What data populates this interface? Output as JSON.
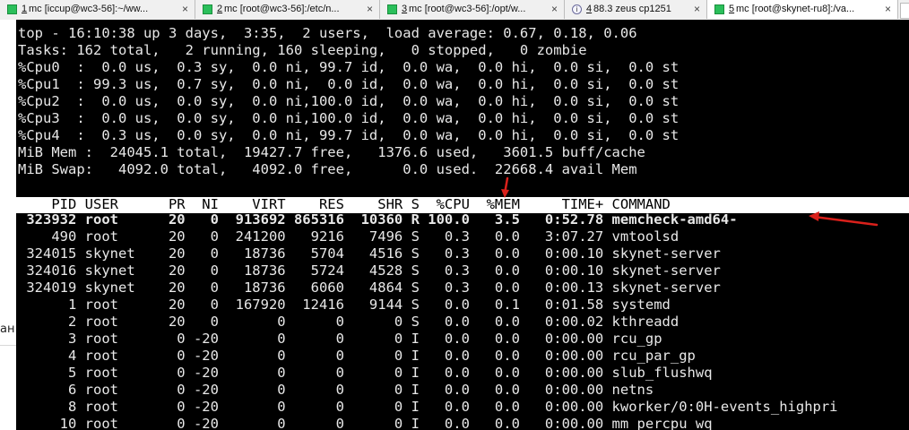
{
  "tabs": [
    {
      "num": "1",
      "label": "mc [iccup@wc3-56]:~/ww...",
      "close": "×"
    },
    {
      "num": "2",
      "label": "mc [root@wc3-56]:/etc/n...",
      "close": "×"
    },
    {
      "num": "3",
      "label": "mc [root@wc3-56]:/opt/w...",
      "close": "×"
    },
    {
      "num": "4",
      "label": "88.3 zeus cp1251",
      "close": "×"
    },
    {
      "num": "5",
      "label": "mc [root@skynet-ru8]:/va...",
      "close": "×"
    }
  ],
  "left_glyph": "ан",
  "top_summary": [
    "top - 16:10:38 up 3 days,  3:35,  2 users,  load average: 0.67, 0.18, 0.06",
    "Tasks: 162 total,   2 running, 160 sleeping,   0 stopped,   0 zombie",
    "%Cpu0  :  0.0 us,  0.3 sy,  0.0 ni, 99.7 id,  0.0 wa,  0.0 hi,  0.0 si,  0.0 st",
    "%Cpu1  : 99.3 us,  0.7 sy,  0.0 ni,  0.0 id,  0.0 wa,  0.0 hi,  0.0 si,  0.0 st",
    "%Cpu2  :  0.0 us,  0.0 sy,  0.0 ni,100.0 id,  0.0 wa,  0.0 hi,  0.0 si,  0.0 st",
    "%Cpu3  :  0.0 us,  0.0 sy,  0.0 ni,100.0 id,  0.0 wa,  0.0 hi,  0.0 si,  0.0 st",
    "%Cpu4  :  0.3 us,  0.0 sy,  0.0 ni, 99.7 id,  0.0 wa,  0.0 hi,  0.0 si,  0.0 st",
    "MiB Mem :  24045.1 total,  19427.7 free,   1376.6 used,   3601.5 buff/cache",
    "MiB Swap:   4092.0 total,   4092.0 free,      0.0 used.  22668.4 avail Mem"
  ],
  "column_header": "    PID USER      PR  NI    VIRT    RES    SHR S  %CPU  %MEM     TIME+ COMMAND",
  "process_rows": [
    " 323932 root      20   0  913692 865316  10360 R 100.0   3.5   0:52.78 memcheck-amd64-",
    "    490 root      20   0  241200   9216   7496 S   0.3   0.0   3:07.27 vmtoolsd",
    " 324015 skynet    20   0   18736   5704   4516 S   0.3   0.0   0:00.10 skynet-server",
    " 324016 skynet    20   0   18736   5724   4528 S   0.3   0.0   0:00.10 skynet-server",
    " 324019 skynet    20   0   18736   6060   4864 S   0.3   0.0   0:00.13 skynet-server",
    "      1 root      20   0  167920  12416   9144 S   0.0   0.1   0:01.58 systemd",
    "      2 root      20   0       0      0      0 S   0.0   0.0   0:00.02 kthreadd",
    "      3 root       0 -20       0      0      0 I   0.0   0.0   0:00.00 rcu_gp",
    "      4 root       0 -20       0      0      0 I   0.0   0.0   0:00.00 rcu_par_gp",
    "      5 root       0 -20       0      0      0 I   0.0   0.0   0:00.00 slub_flushwq",
    "      6 root       0 -20       0      0      0 I   0.0   0.0   0:00.00 netns",
    "      8 root       0 -20       0      0      0 I   0.0   0.0   0:00.00 kworker/0:0H-events_highpri",
    "     10 root       0 -20       0      0      0 I   0.0   0.0   0:00.00 mm_percpu_wq"
  ],
  "colors": {
    "terminal_bg": "#000000",
    "terminal_fg": "#e8e8e8",
    "header_bg": "#ffffff",
    "arrow_red": "#d9201b",
    "tab_icon_green": "#2bbf5b"
  }
}
